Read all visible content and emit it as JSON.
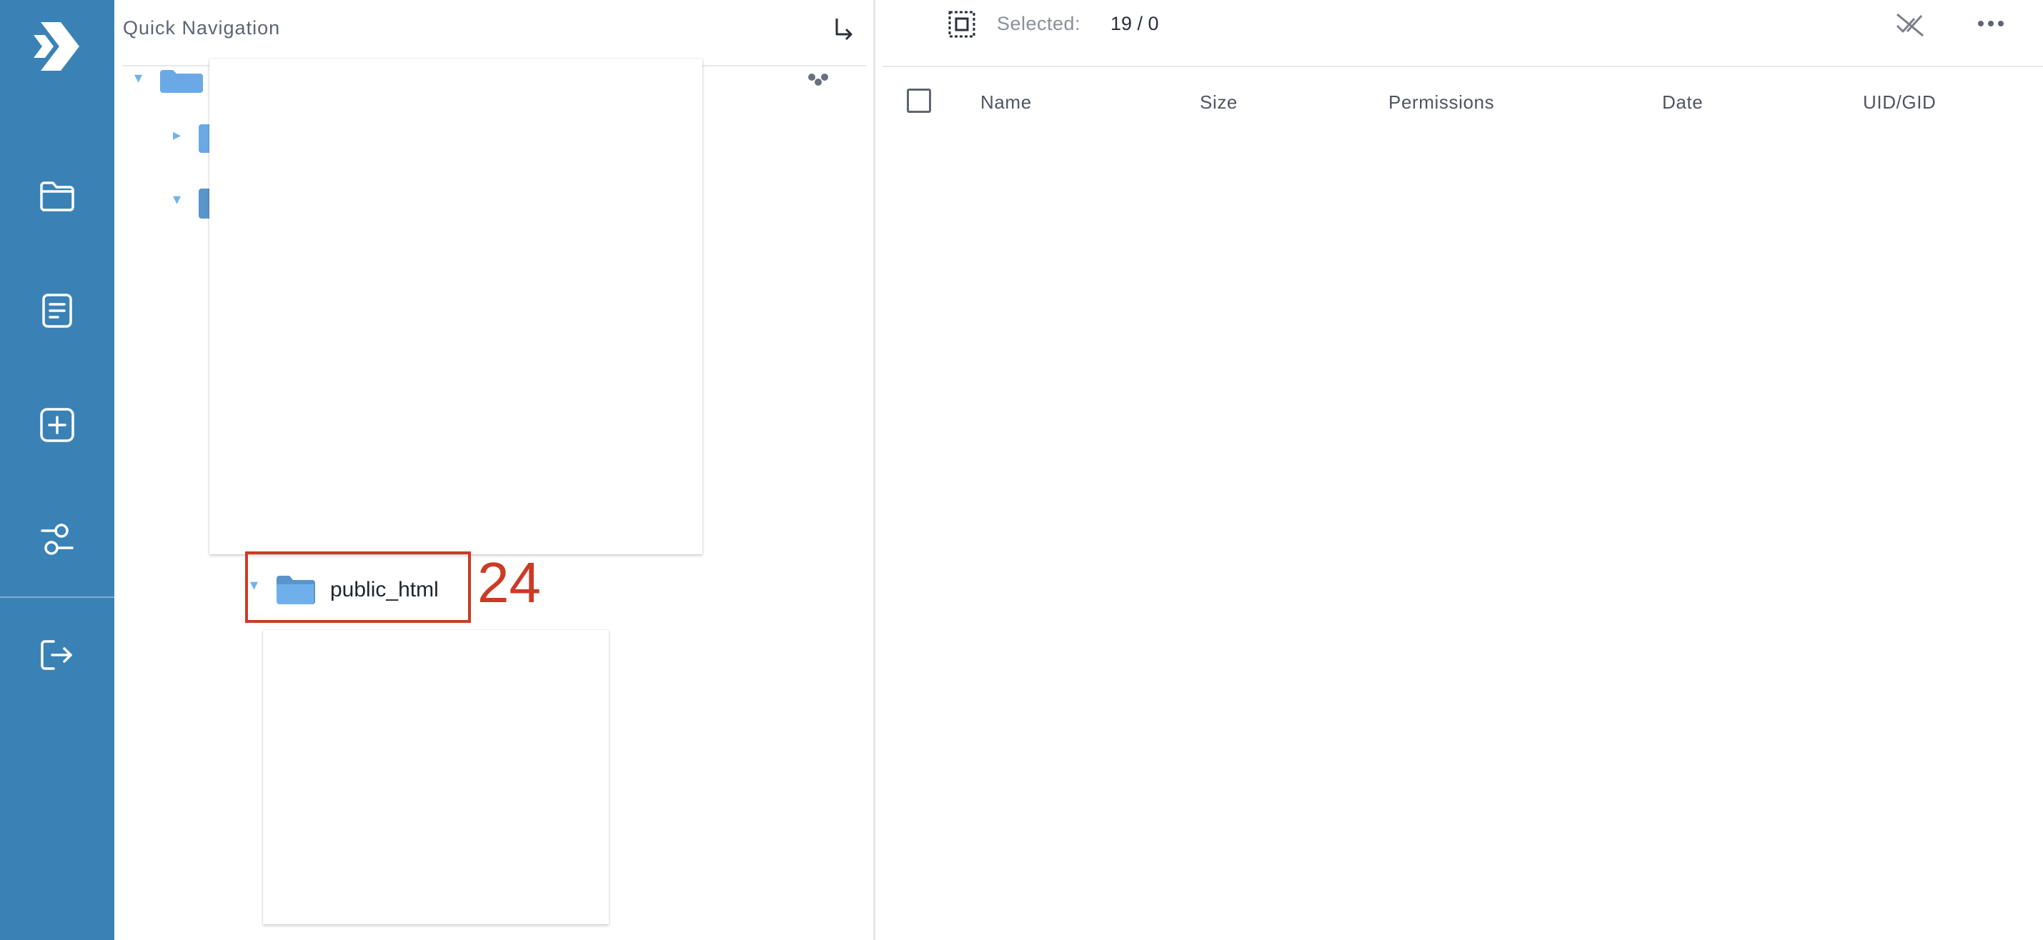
{
  "sidebar": {
    "logo": "chevron-logo-icon",
    "items": [
      {
        "icon": "folder-icon"
      },
      {
        "icon": "document-icon"
      },
      {
        "icon": "plus-square-icon"
      },
      {
        "icon": "settings-sliders-icon"
      },
      {
        "icon": "logout-icon"
      }
    ],
    "color": "#3a82b5"
  },
  "quick_nav": {
    "title": "Quick Navigation",
    "exit_icon": "arrow-down-right-icon",
    "highlighted_folder": {
      "name": "public_html",
      "badge": "24"
    }
  },
  "toolbar": {
    "selected_label": "Selected:",
    "selected_value": "19 / 0",
    "select_icon": "select-box-icon",
    "actions": [
      {
        "icon": "deselect-icon"
      },
      {
        "icon": "more-horizontal-icon"
      }
    ]
  },
  "file_table": {
    "columns": [
      "Name",
      "Size",
      "Permissions",
      "Date",
      "UID/GID"
    ]
  },
  "colors": {
    "accent": "#3a82b5",
    "folder": "#6aa9e6",
    "highlight": "#cc3a25"
  }
}
